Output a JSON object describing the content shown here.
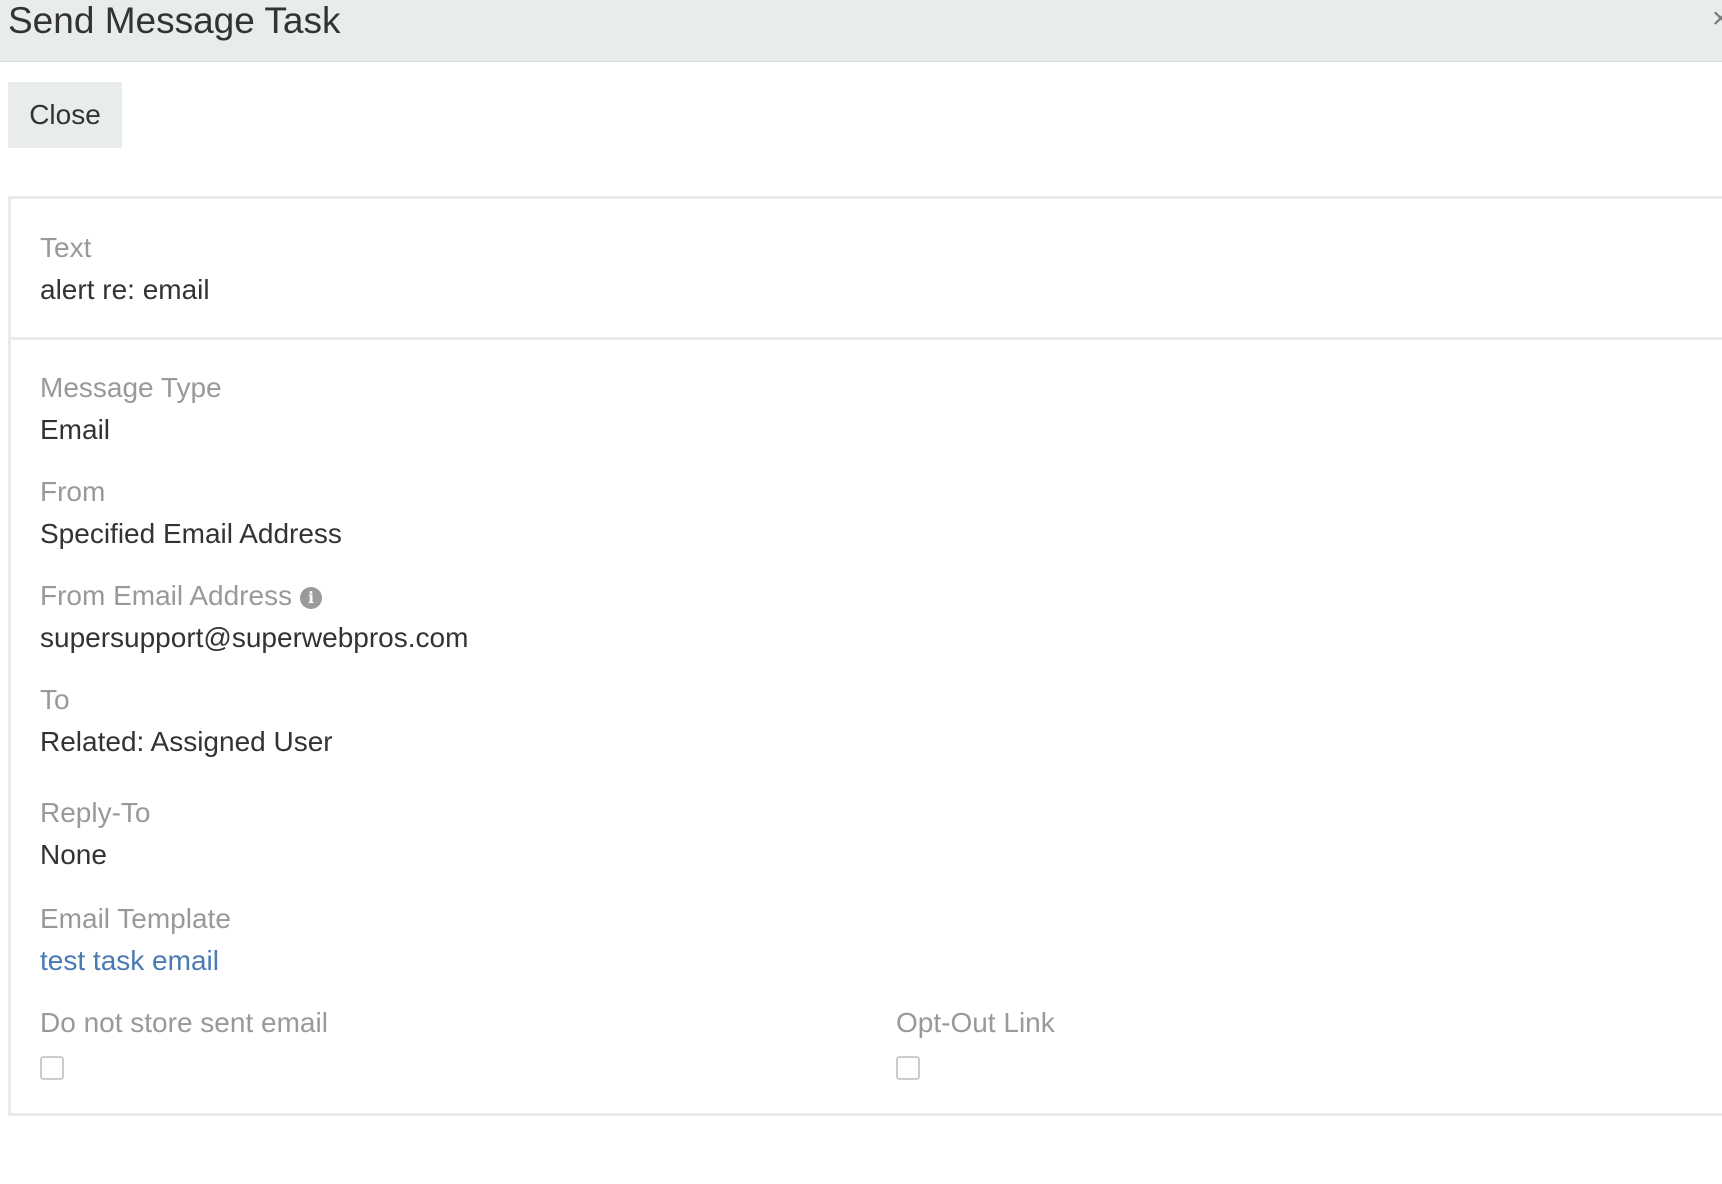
{
  "header": {
    "title": "Send Message Task",
    "close_icon": "close-icon"
  },
  "toolbar": {
    "close_label": "Close"
  },
  "panel": {
    "text": {
      "label": "Text",
      "value": "alert re: email"
    },
    "message_type": {
      "label": "Message Type",
      "value": "Email"
    },
    "from": {
      "label": "From",
      "value": "Specified Email Address"
    },
    "from_email_address": {
      "label": "From Email Address",
      "value": "supersupport@superwebpros.com",
      "info_icon": "info-circle-icon",
      "info_glyph": "i"
    },
    "to": {
      "label": "To",
      "value": "Related: Assigned User"
    },
    "reply_to": {
      "label": "Reply-To",
      "value": "None"
    },
    "email_template": {
      "label": "Email Template",
      "value": "test task email"
    },
    "do_not_store": {
      "label": "Do not store sent email",
      "checked": false
    },
    "opt_out_link": {
      "label": "Opt-Out Link",
      "checked": false
    }
  },
  "colors": {
    "header_bg": "#e8eced",
    "label": "#999999",
    "value": "#333333",
    "link": "#4a7ab1"
  }
}
